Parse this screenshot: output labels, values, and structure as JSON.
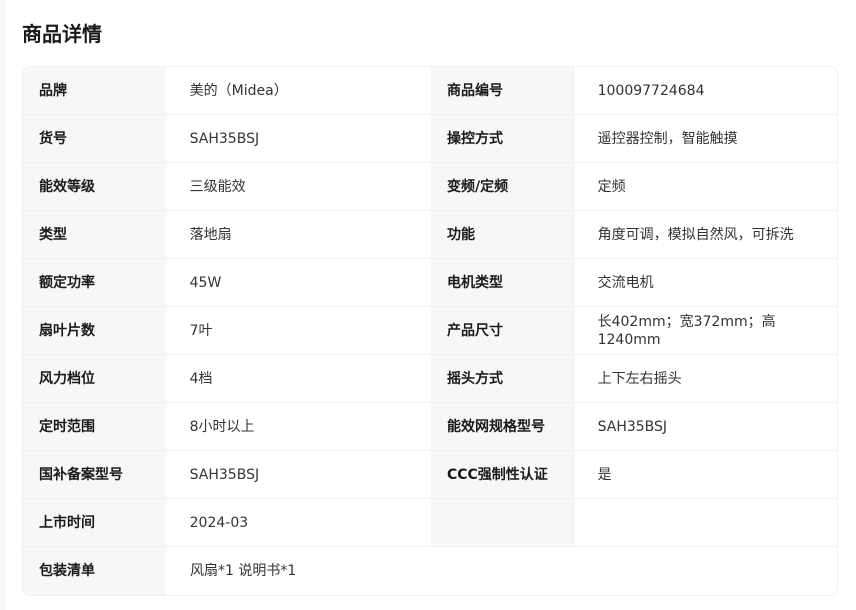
{
  "page": {
    "title": "商品详情"
  },
  "specs": [
    {
      "l1": "品牌",
      "v1": "美的（Midea）",
      "l2": "商品编号",
      "v2": "100097724684"
    },
    {
      "l1": "货号",
      "v1": "SAH35BSJ",
      "l2": "操控方式",
      "v2": "遥控器控制，智能触摸"
    },
    {
      "l1": "能效等级",
      "v1": "三级能效",
      "l2": "变频/定频",
      "v2": "定频"
    },
    {
      "l1": "类型",
      "v1": "落地扇",
      "l2": "功能",
      "v2": "角度可调，模拟自然风，可拆洗"
    },
    {
      "l1": "额定功率",
      "v1": "45W",
      "l2": "电机类型",
      "v2": "交流电机"
    },
    {
      "l1": "扇叶片数",
      "v1": "7叶",
      "l2": "产品尺寸",
      "v2": "长402mm；宽372mm；高1240mm"
    },
    {
      "l1": "风力档位",
      "v1": "4档",
      "l2": "摇头方式",
      "v2": "上下左右摇头"
    },
    {
      "l1": "定时范围",
      "v1": "8小时以上",
      "l2": "能效网规格型号",
      "v2": "SAH35BSJ"
    },
    {
      "l1": "国补备案型号",
      "v1": "SAH35BSJ",
      "l2": "CCC强制性认证",
      "v2": "是"
    },
    {
      "l1": "上市时间",
      "v1": "2024-03",
      "l2": "",
      "v2": ""
    }
  ],
  "package": {
    "label": "包装清单",
    "value": "风扇*1 说明书*1"
  }
}
